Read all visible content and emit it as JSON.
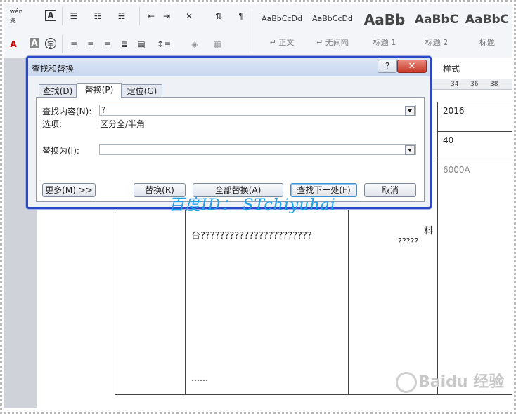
{
  "ribbon": {
    "icons": [
      "phonetic-guide-icon",
      "character-border-icon",
      "bullets-icon",
      "numbering-icon",
      "multilevel-list-icon",
      "decrease-indent-icon",
      "increase-indent-icon",
      "sort-icon",
      "show-marks-icon",
      "font-color-icon",
      "character-shading-icon",
      "enclose-character-icon",
      "align-left-icon",
      "center-icon",
      "align-right-icon",
      "justify-icon",
      "distributed-icon",
      "line-spacing-icon",
      "shading-icon",
      "borders-icon"
    ],
    "labels": {
      "phonetic": "wén 变",
      "border_char": "A",
      "font_color": "A",
      "shading_char": "A",
      "enclose": "字"
    },
    "styles": [
      {
        "sample": "AaBbCcDd",
        "name": "↵ 正文"
      },
      {
        "sample": "AaBbCcDd",
        "name": "↵ 无间隔"
      },
      {
        "sample": "AaBb",
        "name": "标题 1"
      },
      {
        "sample": "AaBbC",
        "name": "标题 2"
      },
      {
        "sample": "AaBbC",
        "name": "标题"
      }
    ]
  },
  "side_panel": {
    "label": "样式"
  },
  "ruler": {
    "ticks": [
      "34",
      "36",
      "38"
    ]
  },
  "document": {
    "cells": {
      "year": "2016",
      "num": "40",
      "model": "6000A",
      "row_text": "台???????????????????????",
      "side_char": "科",
      "side_q": "?????",
      "dots": "……"
    }
  },
  "dialog": {
    "title": "查找和替换",
    "help": "?",
    "close": "✕",
    "tabs": [
      "查找(D)",
      "替换(P)",
      "定位(G)"
    ],
    "active_tab": 1,
    "find_label": "查找内容(N):",
    "find_value": "?",
    "options_label": "选项:",
    "options_value": "区分全/半角",
    "replace_label": "替换为(I):",
    "replace_value": "",
    "buttons": {
      "more": "更多(M) >>",
      "replace": "替换(R)",
      "replace_all": "全部替换(A)",
      "find_next": "查找下一处(F)",
      "cancel": "取消"
    }
  },
  "watermark": "百度ID： STchiyuhai",
  "brand": "Baidu 经验",
  "colors": {
    "dialog_border": "#2a48c7",
    "watermark": "#1ea1e8",
    "close": "#c6392a"
  }
}
